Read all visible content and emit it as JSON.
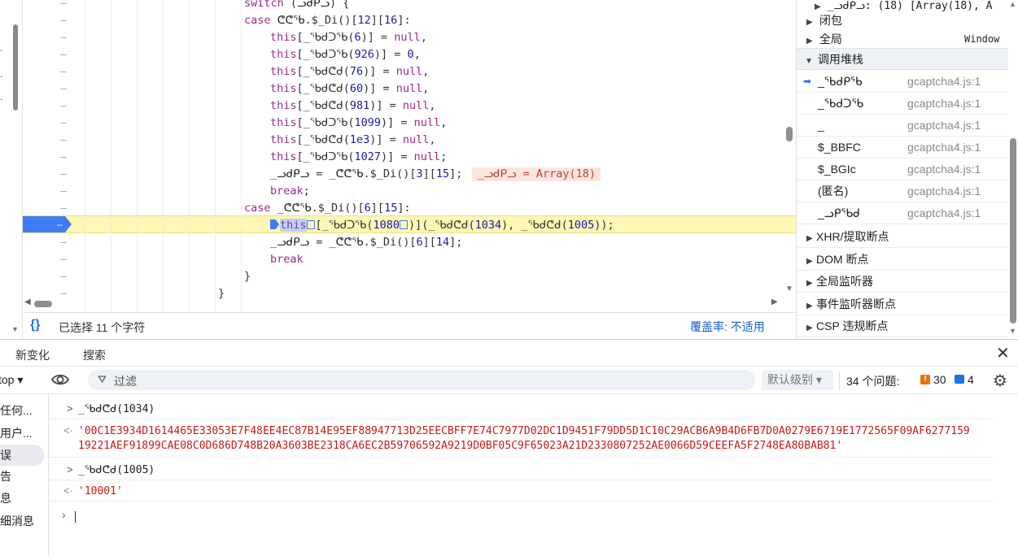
{
  "sources": {
    "lines": [
      {
        "indent": 300,
        "parts": [
          [
            "kw",
            "switch"
          ],
          [
            "pun",
            " ("
          ],
          [
            "id",
            "ᓗᑯᑭᓗ"
          ],
          [
            "pun",
            ") {"
          ]
        ]
      },
      {
        "indent": 300,
        "parts": [
          [
            "kw",
            "case "
          ],
          [
            "id",
            "ᕦᕦᖃ"
          ],
          [
            "pun",
            ".$_Di()["
          ],
          [
            "num",
            "12"
          ],
          [
            "pun",
            "]["
          ],
          [
            "num",
            "16"
          ],
          [
            "pun",
            "]:"
          ]
        ]
      },
      {
        "indent": 332,
        "parts": [
          [
            "kw",
            "this"
          ],
          [
            "pun",
            "[_ᖃᑯᑐᖃ("
          ],
          [
            "num",
            "6"
          ],
          [
            "pun",
            ")] = "
          ],
          [
            "kw",
            "null"
          ],
          [
            "pun",
            ","
          ]
        ]
      },
      {
        "indent": 332,
        "parts": [
          [
            "kw",
            "this"
          ],
          [
            "pun",
            "[_ᖃᑯᑐᖃ("
          ],
          [
            "num",
            "926"
          ],
          [
            "pun",
            ")] = "
          ],
          [
            "num",
            "0"
          ],
          [
            "pun",
            ","
          ]
        ]
      },
      {
        "indent": 332,
        "parts": [
          [
            "kw",
            "this"
          ],
          [
            "pun",
            "[_ᖃᑯᕦᑯ("
          ],
          [
            "num",
            "76"
          ],
          [
            "pun",
            ")] = "
          ],
          [
            "kw",
            "null"
          ],
          [
            "pun",
            ","
          ]
        ]
      },
      {
        "indent": 332,
        "parts": [
          [
            "kw",
            "this"
          ],
          [
            "pun",
            "[_ᖃᑯᕦᑯ("
          ],
          [
            "num",
            "60"
          ],
          [
            "pun",
            ")] = "
          ],
          [
            "kw",
            "null"
          ],
          [
            "pun",
            ","
          ]
        ]
      },
      {
        "indent": 332,
        "parts": [
          [
            "kw",
            "this"
          ],
          [
            "pun",
            "[_ᖃᑯᕦᑯ("
          ],
          [
            "num",
            "981"
          ],
          [
            "pun",
            ")] = "
          ],
          [
            "kw",
            "null"
          ],
          [
            "pun",
            ","
          ]
        ]
      },
      {
        "indent": 332,
        "parts": [
          [
            "kw",
            "this"
          ],
          [
            "pun",
            "[_ᖃᑯᑐᖃ("
          ],
          [
            "num",
            "1099"
          ],
          [
            "pun",
            ")] = "
          ],
          [
            "kw",
            "null"
          ],
          [
            "pun",
            ","
          ]
        ]
      },
      {
        "indent": 332,
        "parts": [
          [
            "kw",
            "this"
          ],
          [
            "pun",
            "[_ᖃᑯᕦᑯ("
          ],
          [
            "num",
            "1e3"
          ],
          [
            "pun",
            ")] = "
          ],
          [
            "kw",
            "null"
          ],
          [
            "pun",
            ","
          ]
        ]
      },
      {
        "indent": 332,
        "parts": [
          [
            "kw",
            "this"
          ],
          [
            "pun",
            "[_ᖃᑯᑐᖃ("
          ],
          [
            "num",
            "1027"
          ],
          [
            "pun",
            ")] = "
          ],
          [
            "kw",
            "null"
          ],
          [
            "pun",
            ";"
          ]
        ]
      },
      {
        "indent": 332,
        "parts": [
          [
            "id",
            "_ᓗᑯᑭᓗ"
          ],
          [
            "pun",
            " = "
          ],
          [
            "id",
            "_ᕦᕦᖃ"
          ],
          [
            "pun",
            ".$_Di()["
          ],
          [
            "num",
            "3"
          ],
          [
            "pun",
            "]["
          ],
          [
            "num",
            "15"
          ],
          [
            "pun",
            "];"
          ]
        ],
        "inline": "_ᓗᑯᑭᓗ = Array(18)"
      },
      {
        "indent": 332,
        "parts": [
          [
            "kw",
            "break"
          ],
          [
            "pun",
            ";"
          ]
        ]
      },
      {
        "indent": 300,
        "parts": [
          [
            "kw",
            "case "
          ],
          [
            "id",
            "_ᕦᕦᖃ"
          ],
          [
            "pun",
            ".$_Di()["
          ],
          [
            "num",
            "6"
          ],
          [
            "pun",
            "]["
          ],
          [
            "num",
            "15"
          ],
          [
            "pun",
            "]:"
          ]
        ]
      },
      {
        "indent": 332,
        "active": true,
        "parts": [
          [
            "kw",
            "this"
          ],
          [
            "pun",
            "[_ᖃᑯᑐᖃ("
          ],
          [
            "num",
            "1080"
          ],
          [
            "pun",
            ")](_ᖃᑯᕦᑯ("
          ],
          [
            "num",
            "1034"
          ],
          [
            "pun",
            "), _ᖃᑯᕦᑯ("
          ],
          [
            "num",
            "1005"
          ],
          [
            "pun",
            "));"
          ]
        ]
      },
      {
        "indent": 332,
        "parts": [
          [
            "id",
            "_ᓗᑯᑭᓗ"
          ],
          [
            "pun",
            " = "
          ],
          [
            "id",
            "_ᕦᕦᖃ"
          ],
          [
            "pun",
            ".$_Di()["
          ],
          [
            "num",
            "6"
          ],
          [
            "pun",
            "]["
          ],
          [
            "num",
            "14"
          ],
          [
            "pun",
            "];"
          ]
        ]
      },
      {
        "indent": 332,
        "parts": [
          [
            "kw",
            "break"
          ]
        ]
      },
      {
        "indent": 300,
        "parts": [
          [
            "pun",
            "}"
          ]
        ]
      },
      {
        "indent": 268,
        "parts": [
          [
            "pun",
            "}"
          ]
        ]
      }
    ],
    "gutter_mark": "–",
    "selection_status": "已选择 11 个字符",
    "coverage": "覆盖率: 不适用"
  },
  "right_pane": {
    "scope_top": "_ᓗᑯᑭᓗ: (18)  [Array(18), A",
    "closure": "闭包",
    "global": "全局",
    "global_value": "Window",
    "call_stack_title": "调用堆栈",
    "frames": [
      {
        "name": "_ᖃᑯᑭᖃ",
        "loc": "gcaptcha4.js:1",
        "current": true
      },
      {
        "name": "_ᖃᑯᑐᖃ",
        "loc": "gcaptcha4.js:1"
      },
      {
        "name": "_",
        "loc": "gcaptcha4.js:1"
      },
      {
        "name": "$_BBFC",
        "loc": "gcaptcha4.js:1"
      },
      {
        "name": "$_BGIc",
        "loc": "gcaptcha4.js:1"
      },
      {
        "name": "(匿名)",
        "loc": "gcaptcha4.js:1"
      },
      {
        "name": "_ᓗᑭᖃᑯ",
        "loc": "gcaptcha4.js:1"
      }
    ],
    "sections": [
      "XHR/提取断点",
      "DOM 断点",
      "全局监听器",
      "事件监听器断点",
      "CSP 违规断点"
    ]
  },
  "drawer": {
    "tabs": [
      "新变化",
      "搜索"
    ]
  },
  "console_toolbar": {
    "context": "top ▾",
    "filter_placeholder": "过滤",
    "levels": "默认级别 ▾",
    "issues": "34 个问题:",
    "errors": "30",
    "messages": "4"
  },
  "console_sidebar": [
    "任何...",
    "用户...",
    "误",
    "告",
    "息",
    "细消息"
  ],
  "console_log": [
    {
      "dir": "in",
      "text": "_ᖃᑯᕦᑯ(1034)"
    },
    {
      "dir": "out",
      "text": "'00C1E3934D1614465E33053E7F48EE4EC87B14E95EF88947713D25EECBFF7E74C7977D02DC1D9451F79DD5D1C10C29ACB6A9B4D6FB7D0A0279E6719E1772565F09AF6277159\n19221AEF91899CAE08C0D686D748B20A3603BE2318CA6EC2B59706592A9219D0BF05C9F65023A21D2330807252AE0066D59CEEFA5F2748EA80BAB81'"
    },
    {
      "dir": "in",
      "text": "_ᖃᑯᕦᑯ(1005)"
    },
    {
      "dir": "out",
      "text": "'10001'"
    }
  ]
}
